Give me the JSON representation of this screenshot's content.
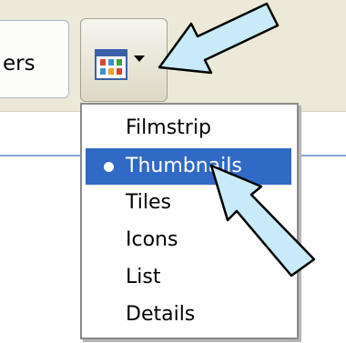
{
  "toolbar": {
    "folders_label_partial": "ers"
  },
  "views_menu": {
    "items": [
      {
        "label": "Filmstrip",
        "selected": false
      },
      {
        "label": "Thumbnails",
        "selected": true
      },
      {
        "label": "Tiles",
        "selected": false
      },
      {
        "label": "Icons",
        "selected": false
      },
      {
        "label": "List",
        "selected": false
      },
      {
        "label": "Details",
        "selected": false
      }
    ]
  },
  "icons": {
    "views_button": "views-icon",
    "dropdown": "chevron-down-icon",
    "selected_marker": "bullet-icon",
    "annotation": "arrow-icon"
  },
  "colors": {
    "selection": "#316ac5",
    "toolbar": "#ece9d8",
    "annotation_arrow": "#c9eaf8"
  }
}
